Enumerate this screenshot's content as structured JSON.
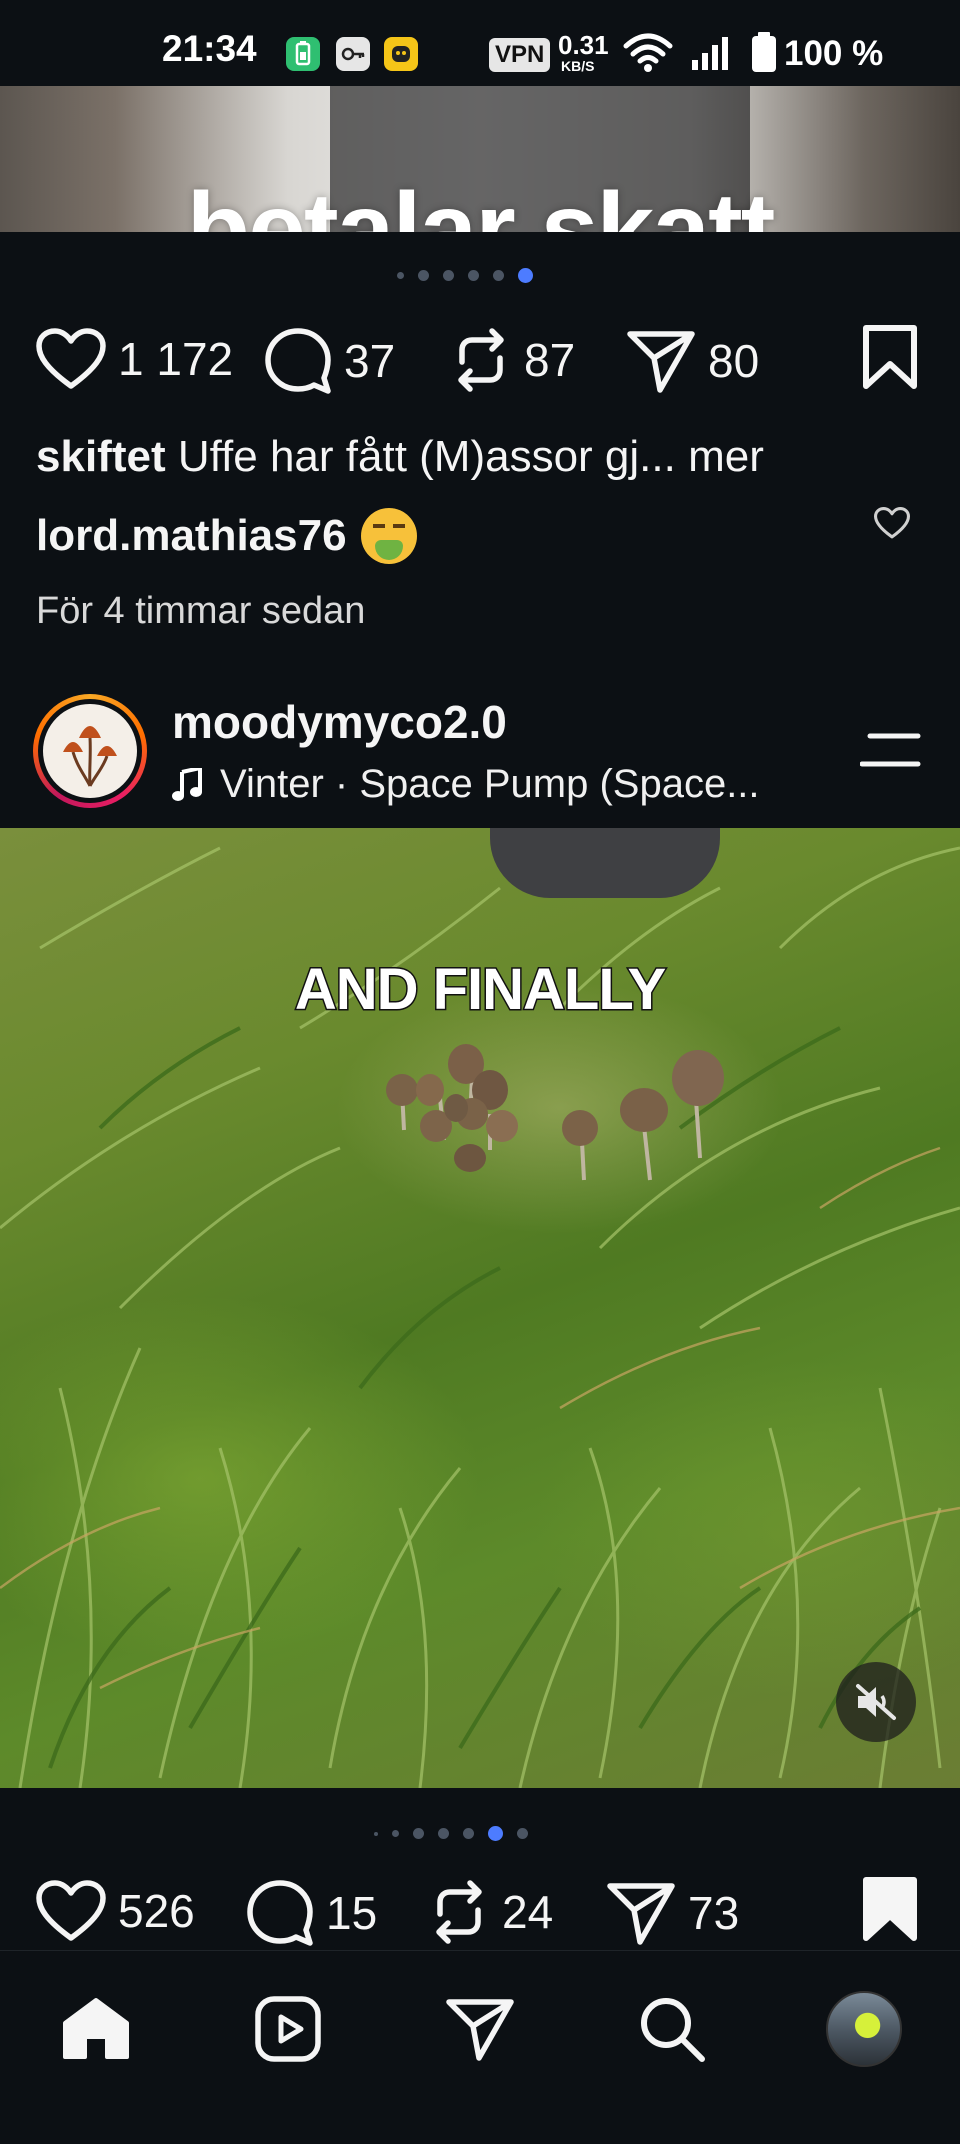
{
  "status_bar": {
    "time": "21:34",
    "vpn": "VPN",
    "speed_value": "0.31",
    "speed_unit": "KB/S",
    "battery": "100 %",
    "icons": [
      "battery-saver-icon",
      "key-icon",
      "app-notification-icon",
      "wifi-icon",
      "signal-icon",
      "battery-icon"
    ]
  },
  "prev_post": {
    "image_caption": "betalar skatt",
    "carousel": {
      "count": 6,
      "active_index": 5
    },
    "likes": "1 172",
    "comments": "37",
    "reposts": "87",
    "shares": "80",
    "caption_user": "skiftet",
    "caption_text": "Uffe har fått (M)assor gj...",
    "caption_more": "mer",
    "comment_user": "lord.mathias76",
    "comment_emoji": "face-vomiting-emoji",
    "timestamp": "För 4 timmar sedan"
  },
  "post": {
    "username": "moodymyco2.0",
    "music": "Vinter · Space Pump (Space...",
    "media_text": "AND FINALLY",
    "carousel": {
      "count": 7,
      "active_index": 5
    },
    "likes": "526",
    "comments": "15",
    "reposts": "24",
    "shares": "73",
    "bookmarked": true
  },
  "bottom_nav": {
    "items": [
      "home-icon",
      "reels-icon",
      "direct-send-icon",
      "search-icon",
      "profile-avatar"
    ],
    "active": "home-icon"
  },
  "colors": {
    "background": "#0c1014",
    "accent_dot": "#4d7cff",
    "text": "#f5f5f5"
  }
}
